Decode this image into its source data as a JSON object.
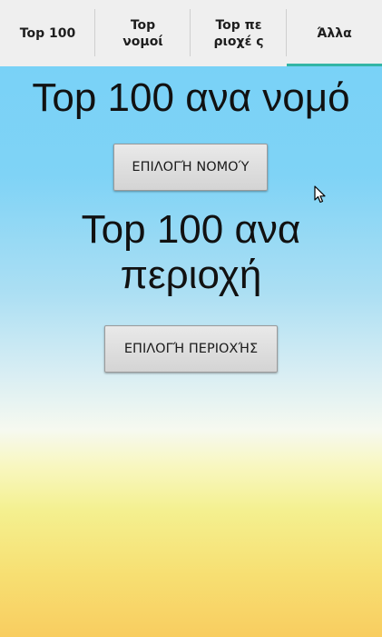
{
  "tabs": [
    {
      "label": "Top 100"
    },
    {
      "label": "Top νομοί"
    },
    {
      "label": "Top περιοχέ ς"
    },
    {
      "label": "Άλλα"
    }
  ],
  "main": {
    "heading_prefecture": "Top 100 ανα νομό",
    "select_prefecture_button": "ΕΠΙΛΟΓΉ ΝΟΜΟΎ",
    "heading_area": "Top 100 ανα περιοχή",
    "select_area_button": "ΕΠΙΛΟΓΉ ΠΕΡΙΟΧΉΣ"
  },
  "colors": {
    "tab_indicator": "#33b5a5",
    "tabbar_background": "#efefef"
  },
  "icons": {
    "cursor": "mouse-pointer-icon"
  }
}
